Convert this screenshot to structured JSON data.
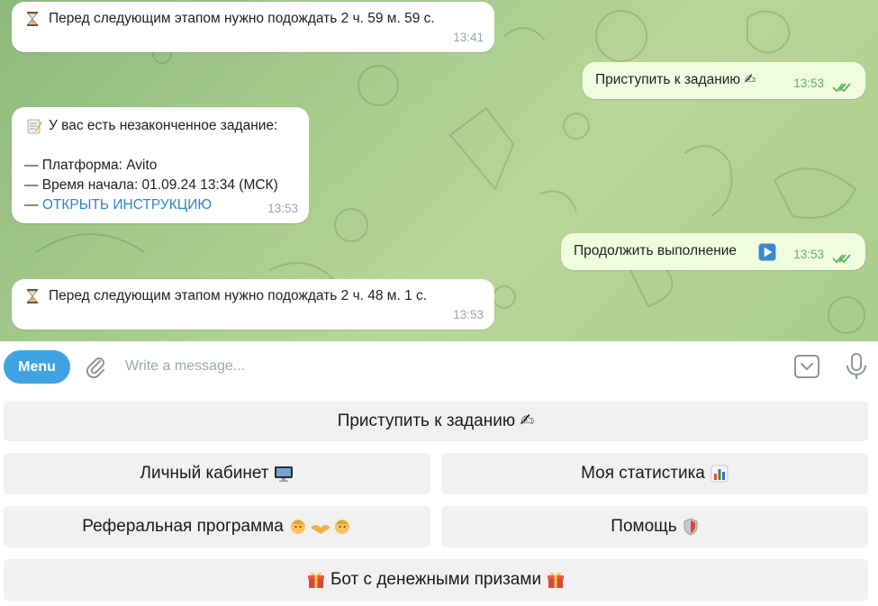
{
  "messages": [
    {
      "text": "Перед следующим этапом нужно подождать 2 ч. 59 м. 59 с.",
      "time": "13:41",
      "icon": "hourglass-icon"
    },
    {
      "text": "Приступить к заданию ✍",
      "time": "13:53"
    },
    {
      "line1": "У вас есть незаконченное задание:",
      "line2": "— Платформа: Avito",
      "line3": "— Время начала: 01.09.24 13:34 (МСК)",
      "line4_prefix": "— ",
      "link": "ОТКРЫТЬ ИНСТРУКЦИЮ",
      "time": "13:53",
      "icon": "memo-icon"
    },
    {
      "text": "Продолжить выполнение",
      "time": "13:53",
      "icon": "play-button-icon"
    },
    {
      "text": "Перед следующим этапом нужно подождать 2 ч. 48 м. 1 с.",
      "time": "13:53",
      "icon": "hourglass-icon"
    }
  ],
  "input": {
    "menu_label": "Menu",
    "placeholder": "Write a message..."
  },
  "keyboard": {
    "start_task": "Приступить к заданию ✍",
    "cabinet": "Личный кабинет",
    "stats": "Моя статистика",
    "referral": "Реферальная программа",
    "help": "Помощь",
    "prize_bot": "Бот с денежными призами"
  },
  "colors": {
    "accent": "#3fa3e3",
    "link": "#2a86c9",
    "outgoing_bubble": "#effdde",
    "read_ticks": "#5fb35a"
  }
}
